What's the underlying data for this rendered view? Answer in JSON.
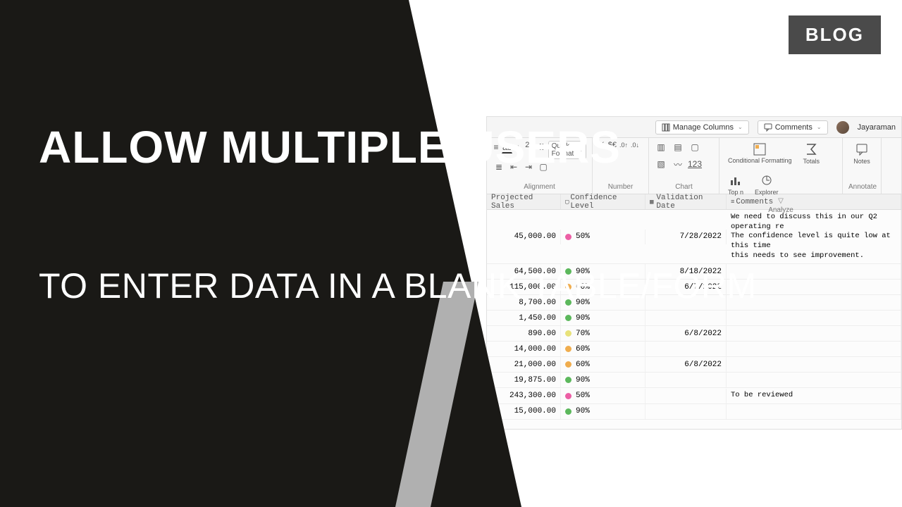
{
  "badge": "BLOG",
  "title_main": "ALLOW MULTIPLE USERS",
  "title_sub": "TO ENTER DATA IN A BLANK TABLE/FORM",
  "topbar": {
    "manage_columns": "Manage Columns",
    "comments": "Comments",
    "user_name": "Jayaraman"
  },
  "ribbon": {
    "spinner_value": "26",
    "quick_format": "Quick Format",
    "number_symbols": "% $€ .0 .0",
    "groups": {
      "alignment": "Alignment",
      "number": "Number",
      "chart": "Chart",
      "analyze": "Analyze",
      "annotate": "Annotate"
    },
    "buttons": {
      "conditional_formatting": "Conditional Formatting",
      "totals": "Totals",
      "top_n": "Top n",
      "explorer": "Explorer",
      "notes": "Notes"
    },
    "chart_label": "123"
  },
  "columns": {
    "projected_sales": "Projected Sales",
    "confidence_level": "Confidence Level",
    "validation_date": "Validation Date",
    "comments": "Comments"
  },
  "colors": {
    "pink": "#ec5fa5",
    "green": "#5cb85c",
    "orange": "#f0ad4e",
    "yellow": "#e8e27a"
  },
  "rows": [
    {
      "sales": "45,000.00",
      "conf": "50%",
      "color": "pink",
      "date": "7/28/2022",
      "comment": "We need to discuss this in our Q2 operating re\nThe confidence level is quite low at this time\nthis needs to see improvement."
    },
    {
      "sales": "64,500.00",
      "conf": "90%",
      "color": "green",
      "date": "8/18/2022",
      "comment": ""
    },
    {
      "sales": "115,000.00",
      "conf": "60%",
      "color": "orange",
      "date": "6/7/2022",
      "comment": ""
    },
    {
      "sales": "8,700.00",
      "conf": "90%",
      "color": "green",
      "date": "",
      "comment": ""
    },
    {
      "sales": "1,450.00",
      "conf": "90%",
      "color": "green",
      "date": "",
      "comment": ""
    },
    {
      "sales": "890.00",
      "conf": "70%",
      "color": "yellow",
      "date": "6/8/2022",
      "comment": ""
    },
    {
      "sales": "14,000.00",
      "conf": "60%",
      "color": "orange",
      "date": "",
      "comment": ""
    },
    {
      "sales": "21,000.00",
      "conf": "60%",
      "color": "orange",
      "date": "6/8/2022",
      "comment": ""
    },
    {
      "sales": "19,875.00",
      "conf": "90%",
      "color": "green",
      "date": "",
      "comment": ""
    },
    {
      "sales": "243,300.00",
      "conf": "50%",
      "color": "pink",
      "date": "",
      "comment": "To be reviewed"
    },
    {
      "sales": "15,000.00",
      "conf": "90%",
      "color": "green",
      "date": "",
      "comment": ""
    }
  ]
}
